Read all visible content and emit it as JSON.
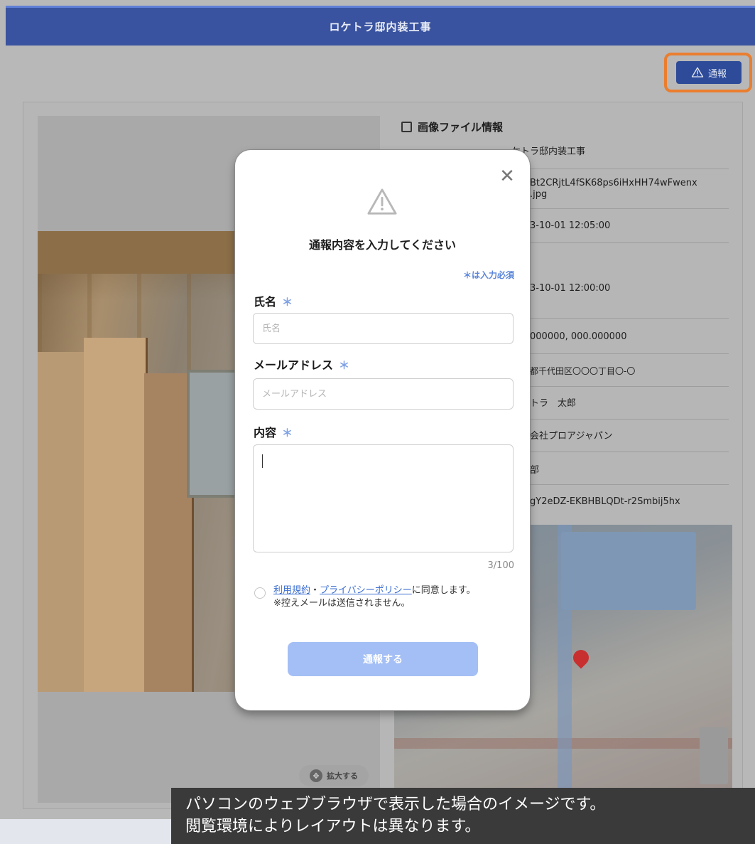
{
  "header": {
    "title": "ロケトラ邸内装工事"
  },
  "toolbar": {
    "report_label": "通報"
  },
  "image_info": {
    "title": "画像ファイル情報",
    "rows": [
      "ケトラ邸内装工事",
      "Bt2CRjtL4fSK68ps6iHxHH74wFwenx",
      ".jpg",
      "3-10-01 12:05:00",
      "3-10-01 12:00:00",
      "000000, 000.000000",
      "都千代田区〇〇〇丁目〇-〇",
      "トラ　太郎",
      "会社プロアジャパン",
      "部",
      "gY2eDZ-EKBHBLQDt-r2Smbij5hx"
    ]
  },
  "zoom": {
    "label": "拡大する"
  },
  "modal": {
    "title": "通報内容を入力してください",
    "required_note": "＊は入力必須",
    "required_mark": "＊",
    "name": {
      "label": "氏名",
      "placeholder": "氏名",
      "value": ""
    },
    "email": {
      "label": "メールアドレス",
      "placeholder": "メールアドレス",
      "value": ""
    },
    "content": {
      "label": "内容",
      "value": "",
      "counter": "3/100"
    },
    "agree": {
      "terms_link": "利用規約",
      "separator": "・",
      "privacy_link": "プライバシーポリシー",
      "suffix": "に同意します。",
      "note": "※控えメールは送信されません。"
    },
    "submit_label": "通報する"
  },
  "caption": {
    "line1": "パソコンのウェブブラウザで表示した場合のイメージです。",
    "line2": "閲覧環境によりレイアウトは異なります。"
  },
  "colors": {
    "header": "#3a53a0",
    "highlight": "#ea7e2f",
    "accent": "#5b86d9",
    "submit_disabled": "#a4bff5"
  },
  "icons": {
    "report": "warning-icon",
    "close": "close-icon",
    "info": "image-icon",
    "zoom": "zoom-icon"
  }
}
